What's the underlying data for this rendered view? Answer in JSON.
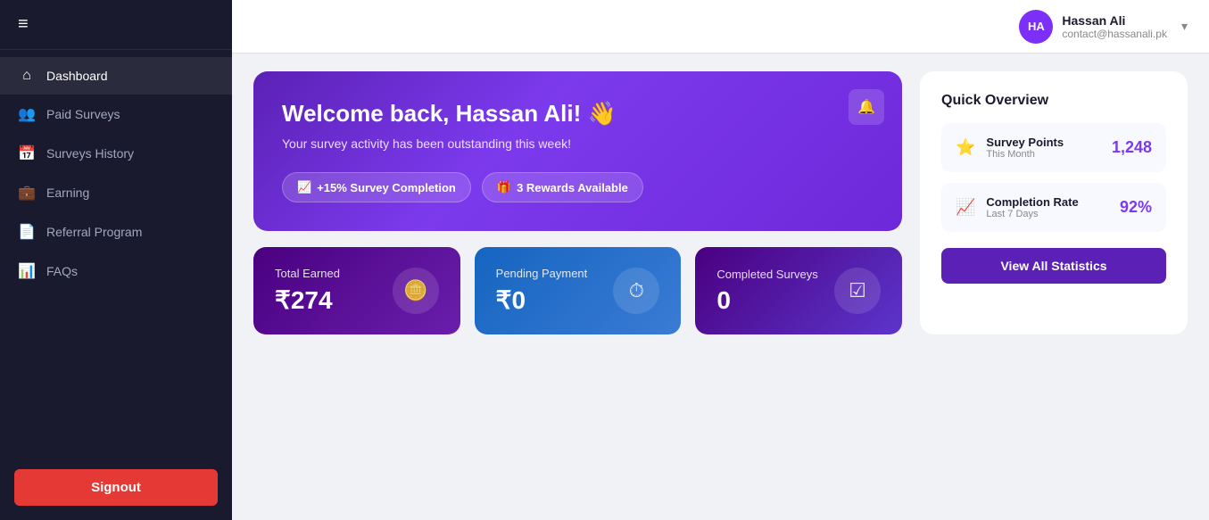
{
  "sidebar": {
    "hamburger": "≡",
    "nav_items": [
      {
        "label": "Dashboard",
        "icon": "⌂",
        "active": true
      },
      {
        "label": "Paid Surveys",
        "icon": "👥",
        "active": false
      },
      {
        "label": "Surveys History",
        "icon": "📅",
        "active": false
      },
      {
        "label": "Earning",
        "icon": "💼",
        "active": false
      },
      {
        "label": "Referral Program",
        "icon": "📄",
        "active": false
      },
      {
        "label": "FAQs",
        "icon": "📊",
        "active": false
      }
    ],
    "signout_label": "Signout"
  },
  "topbar": {
    "avatar_initials": "HA",
    "user_name": "Hassan Ali",
    "user_email": "contact@hassanali.pk"
  },
  "welcome": {
    "title": "Welcome back, Hassan Ali! 👋",
    "subtitle": "Your survey activity has been outstanding this week!",
    "badge_completion": "+15% Survey Completion",
    "badge_rewards": "3 Rewards Available"
  },
  "quick_overview": {
    "title": "Quick Overview",
    "survey_points_label": "Survey Points",
    "survey_points_sub": "This Month",
    "survey_points_value": "1,248",
    "completion_rate_label": "Completion Rate",
    "completion_rate_sub": "Last 7 Days",
    "completion_rate_value": "92%",
    "view_stats_btn": "View All Statistics"
  },
  "metrics": {
    "total_earned_label": "Total Earned",
    "total_earned_value": "₹274",
    "pending_payment_label": "Pending Payment",
    "pending_payment_value": "₹0",
    "completed_surveys_label": "Completed Surveys",
    "completed_surveys_value": "0"
  }
}
